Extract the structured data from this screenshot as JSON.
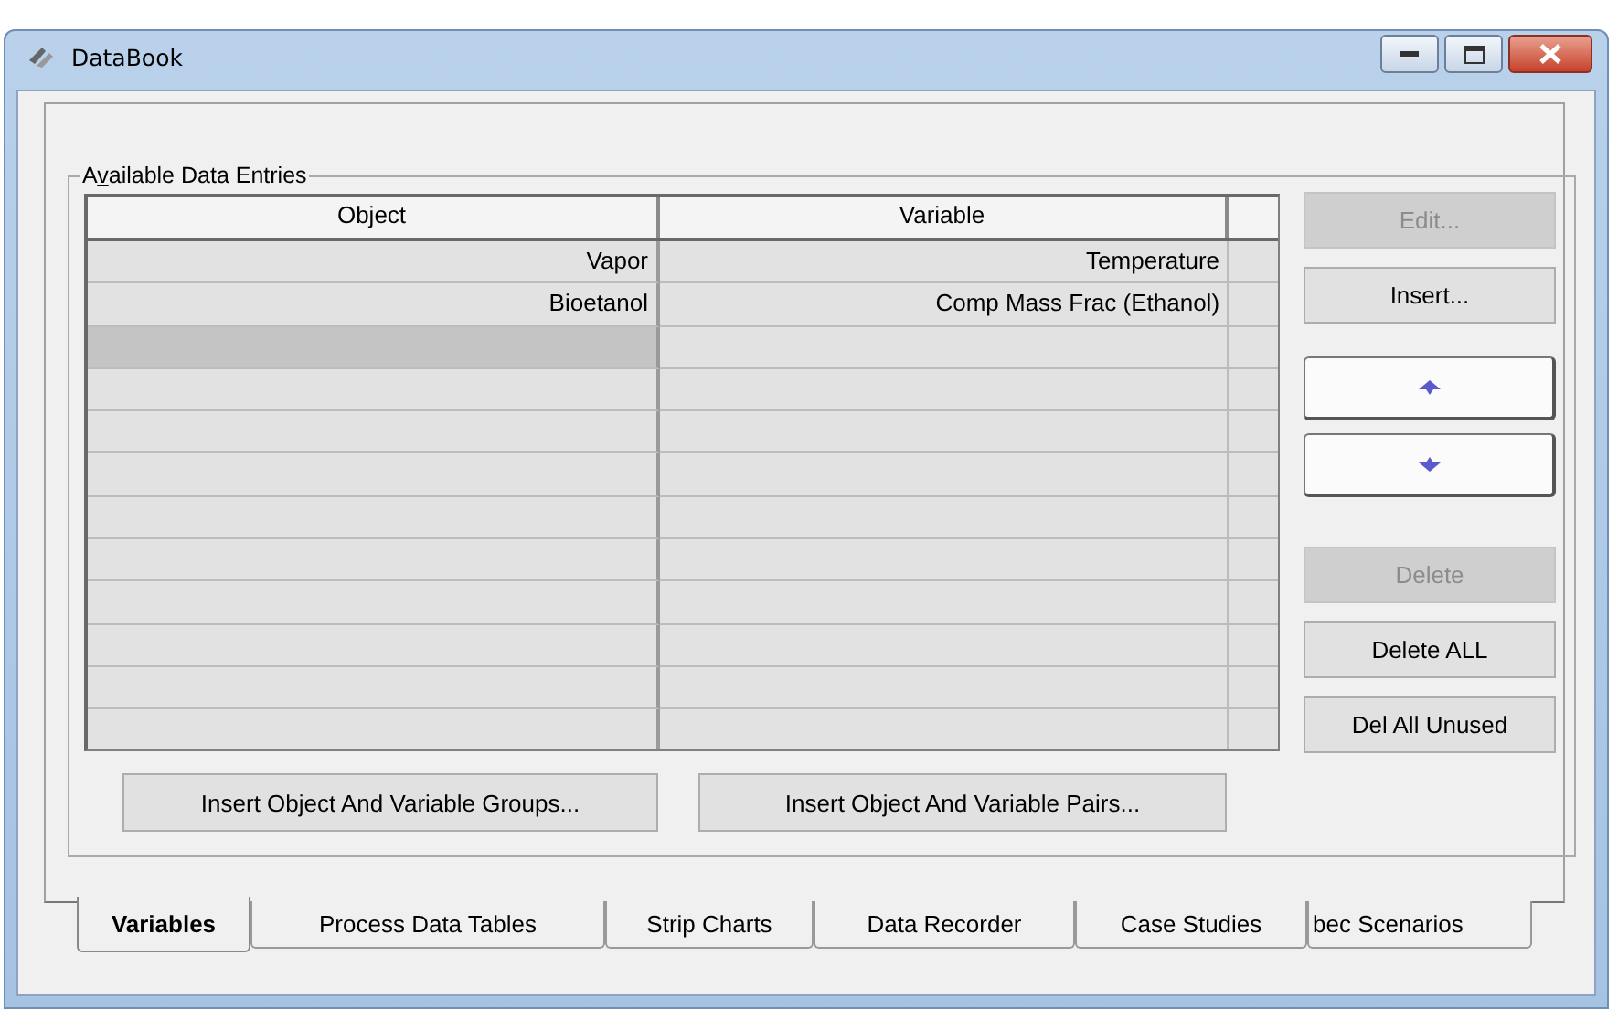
{
  "window": {
    "title": "DataBook"
  },
  "group": {
    "label": "Available Data Entries"
  },
  "table": {
    "columns": [
      "Object",
      "Variable"
    ],
    "rows": [
      {
        "object": "Vapor",
        "variable": "Temperature",
        "selected": false
      },
      {
        "object": "Bioetanol",
        "variable": "Comp Mass Frac (Ethanol)",
        "selected": false
      },
      {
        "selected": true
      }
    ]
  },
  "side_buttons": [
    {
      "kind": "text",
      "label": "Edit...",
      "disabled": true
    },
    {
      "kind": "text",
      "label": "Insert...",
      "disabled": false
    },
    {
      "kind": "up",
      "disabled": false
    },
    {
      "kind": "down",
      "disabled": false
    },
    {
      "kind": "text",
      "label": "Delete",
      "disabled": true
    },
    {
      "kind": "text",
      "label": "Delete ALL",
      "disabled": false
    },
    {
      "kind": "text",
      "label": "Del All Unused",
      "disabled": false
    }
  ],
  "bottom_buttons": [
    "Insert Object And Variable Groups...",
    "Insert Object And Variable Pairs..."
  ],
  "tabs": [
    {
      "label": "Variables",
      "selected": true
    },
    {
      "label": "Process Data Tables",
      "selected": false
    },
    {
      "label": "Strip Charts",
      "selected": false
    },
    {
      "label": "Data Recorder",
      "selected": false
    },
    {
      "label": "Case Studies",
      "selected": false
    },
    {
      "label": "bec Scenarios",
      "selected": false
    }
  ]
}
